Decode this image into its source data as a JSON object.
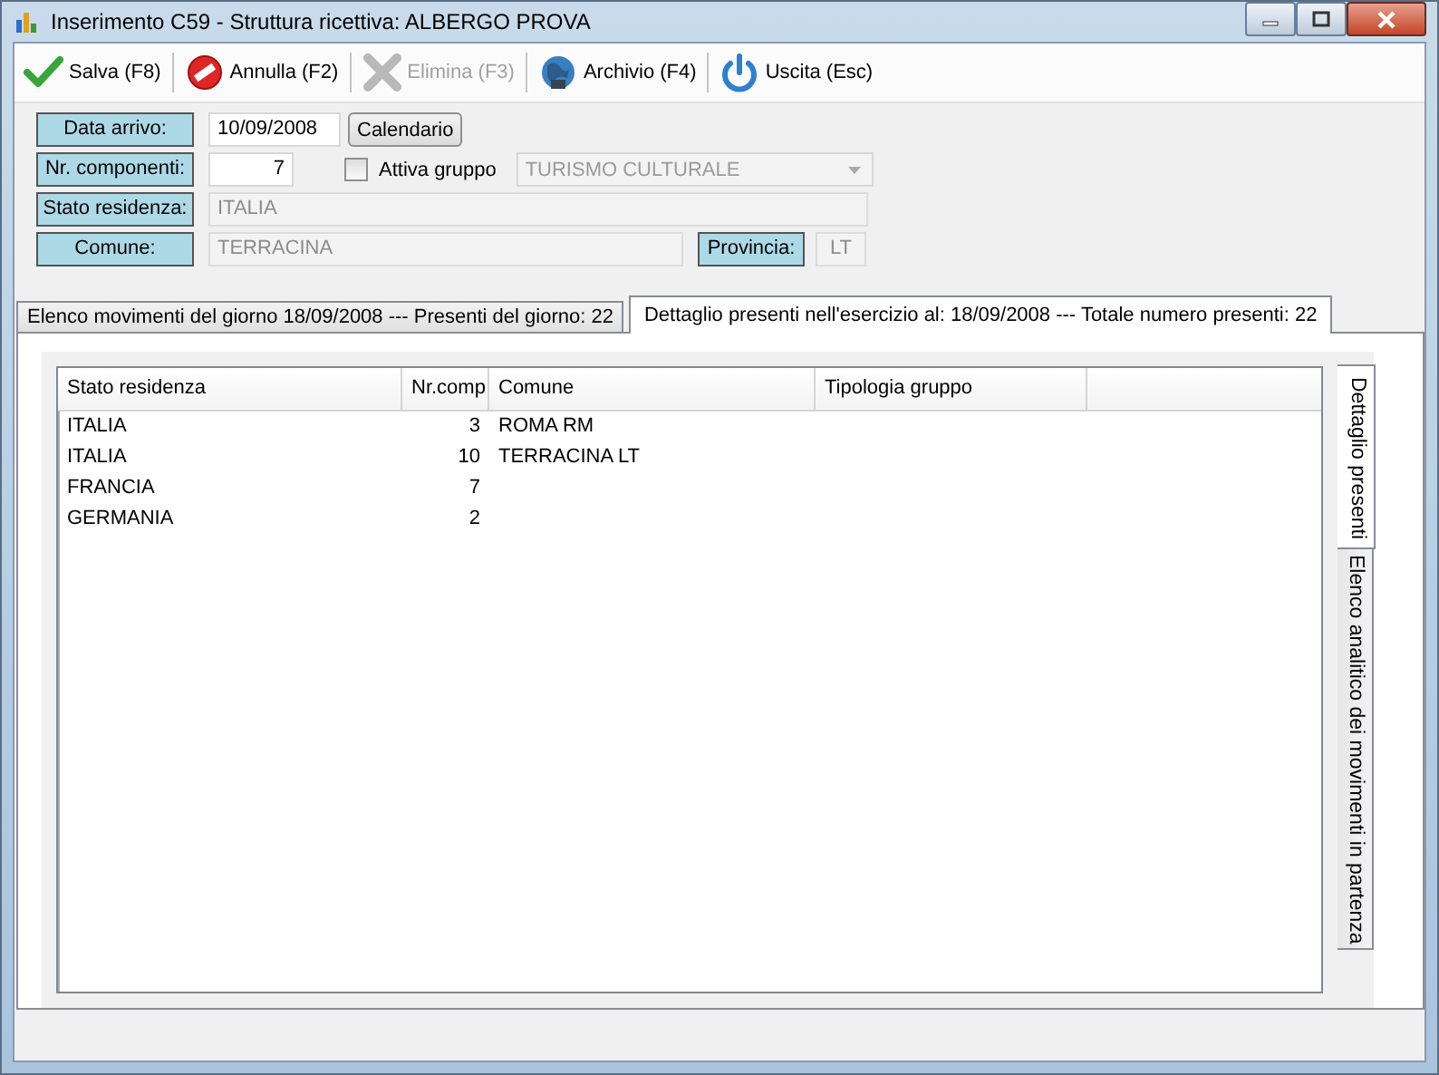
{
  "window": {
    "title": "Inserimento C59 - Struttura ricettiva: ALBERGO PROVA"
  },
  "toolbar": [
    {
      "label": "Salva (F8)",
      "disabled": false
    },
    {
      "label": "Annulla (F2)",
      "disabled": false
    },
    {
      "label": "Elimina (F3)",
      "disabled": true
    },
    {
      "label": "Archivio (F4)",
      "disabled": false
    },
    {
      "label": "Uscita (Esc)",
      "disabled": false
    }
  ],
  "form": {
    "data_arrivo": {
      "label": "Data arrivo:",
      "value": "10/09/2008"
    },
    "calendar_button": "Calendario",
    "nr_componenti": {
      "label": "Nr. componenti:",
      "value": "7"
    },
    "attiva_gruppo": {
      "label": "Attiva gruppo",
      "checked": false
    },
    "tipologia": {
      "value": "TURISMO CULTURALE",
      "disabled": true
    },
    "stato_residenza": {
      "label": "Stato residenza:",
      "value": "ITALIA",
      "disabled": true
    },
    "comune": {
      "label": "Comune:",
      "value": "TERRACINA",
      "disabled": true
    },
    "provincia": {
      "label": "Provincia:",
      "value": "LT",
      "disabled": true
    }
  },
  "tabs": [
    {
      "label": "Elenco movimenti del giorno 18/09/2008 --- Presenti del giorno: 22",
      "selected": false
    },
    {
      "label": "Dettaglio presenti nell'esercizio al: 18/09/2008 --- Totale numero presenti: 22",
      "selected": true
    }
  ],
  "side_tabs": [
    {
      "label": "Dettaglio presenti",
      "selected": true
    },
    {
      "label": "Elenco analitico dei movimenti in partenza",
      "selected": false
    }
  ],
  "table": {
    "columns": [
      {
        "label": "Stato residenza"
      },
      {
        "label": "Nr.comp"
      },
      {
        "label": "Comune"
      },
      {
        "label": "Tipologia gruppo"
      }
    ],
    "rows": [
      [
        "ITALIA",
        "3",
        "ROMA RM",
        ""
      ],
      [
        "ITALIA",
        "10",
        "TERRACINA LT",
        ""
      ],
      [
        "FRANCIA",
        "7",
        "",
        ""
      ],
      [
        "GERMANIA",
        "2",
        "",
        ""
      ]
    ]
  }
}
